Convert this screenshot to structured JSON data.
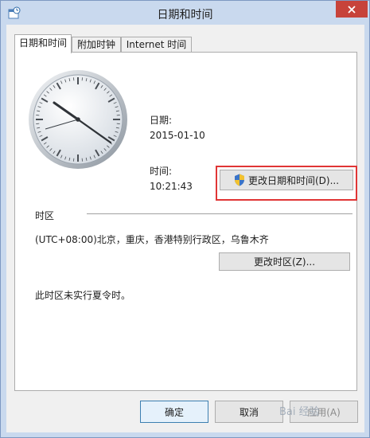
{
  "window": {
    "title": "日期和时间"
  },
  "tabs": [
    {
      "label": "日期和时间",
      "active": true
    },
    {
      "label": "附加时钟",
      "active": false
    },
    {
      "label": "Internet 时间",
      "active": false
    }
  ],
  "datetime": {
    "date_label": "日期:",
    "date_value": "2015-01-10",
    "time_label": "时间:",
    "time_value": "10:21:43",
    "change_button": "更改日期和时间(D)..."
  },
  "timezone": {
    "group_label": "时区",
    "value": "(UTC+08:00)北京，重庆，香港特别行政区，乌鲁木齐",
    "change_button": "更改时区(Z)...",
    "dst_note": "此时区未实行夏令时。"
  },
  "footer": {
    "ok": "确定",
    "cancel": "取消",
    "apply": "应用(A)"
  },
  "watermark": "Bai 经验",
  "colors": {
    "highlight": "#e03535",
    "close": "#c7433a",
    "frame": "#c9d9ee"
  }
}
